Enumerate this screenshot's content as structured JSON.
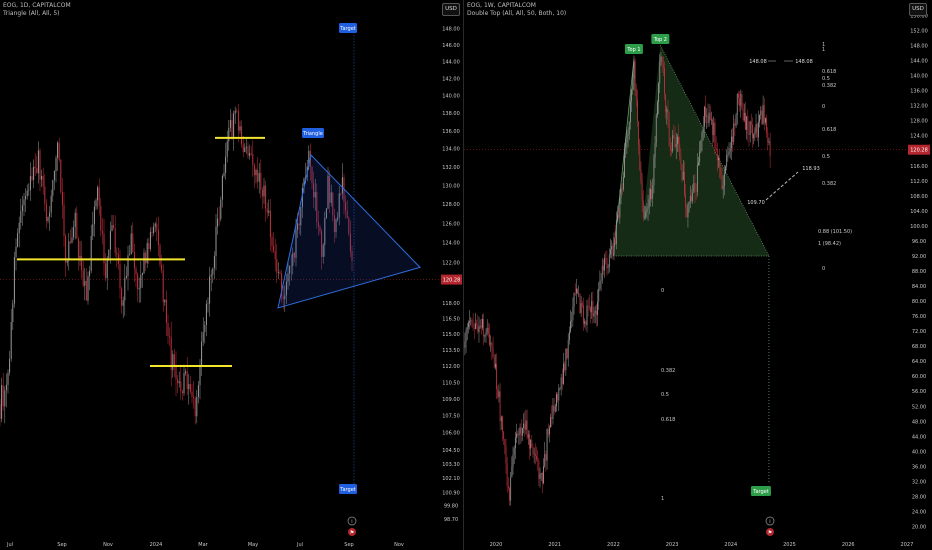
{
  "colors": {
    "up": "#9a9a9a",
    "down": "#c2323c",
    "price_line": "#b3262e",
    "price_badge": "#b3262e",
    "yellow": "#f3e42c",
    "triangle": "#2f6fe0",
    "target_badge": "#1f5fe0",
    "double_top_fill": "#1c3a1c",
    "peak_badge": "#2e9d4a",
    "fib_dash": "#8a8a8a"
  },
  "left_chart": {
    "header": {
      "line1": "EOG, 1D, CAPITALCOM",
      "line2": "Triangle (All, All, 5)"
    },
    "currency_button": "USD",
    "current_price_label": "120.28",
    "pattern_label": "Triangle",
    "target_labels": [
      "Target",
      "Target"
    ],
    "icon_names": [
      "info-circle-icon",
      "flag-icon"
    ]
  },
  "right_chart": {
    "header": {
      "line1": "EOG, 1W, CAPITALCOM",
      "line2": "Double Top (All, All, 50, Both, 10)"
    },
    "currency_button": "USD",
    "current_price_label": "120.28",
    "peak_labels": [
      "Top 1",
      "Top 2"
    ],
    "target_label": "Target",
    "price_annotations": [
      "148.08",
      "148.08",
      "118.93",
      "109.70"
    ],
    "fib_labels_upper": [
      "1",
      "1",
      "0.618",
      "0.5",
      "0.382",
      "0",
      "0.618",
      "0.5",
      "0.382",
      "0.88 (101.50)",
      "1 (98.42)",
      "0"
    ],
    "fib_labels_lower": [
      "0",
      "0.382",
      "0.5",
      "0.618",
      "1"
    ],
    "icon_names": [
      "info-circle-icon",
      "flag-icon"
    ]
  },
  "chart_data": [
    {
      "type": "candlestick",
      "title": "EOG, 1D, CAPITALCOM",
      "subtitle": "Triangle (All, All, 5)",
      "y_axis": {
        "ticks": [
          148.0,
          146.0,
          144.0,
          142.0,
          140.0,
          138.0,
          136.0,
          134.0,
          132.0,
          130.0,
          128.0,
          126.0,
          124.0,
          122.0,
          120.28,
          118.0,
          116.5,
          115.0,
          113.5,
          112.0,
          110.5,
          109.0,
          107.5,
          106.0,
          104.5,
          103.3,
          102.1,
          100.9,
          99.8,
          98.7
        ],
        "tick_labels": [
          "148.00",
          "146.00",
          "144.00",
          "142.00",
          "140.00",
          "138.00",
          "136.00",
          "134.00",
          "132.00",
          "130.00",
          "128.00",
          "126.00",
          "124.00",
          "122.00",
          "120.28",
          "118.00",
          "116.50",
          "115.00",
          "113.50",
          "112.00",
          "110.50",
          "109.00",
          "107.50",
          "106.00",
          "104.50",
          "103.30",
          "102.10",
          "100.90",
          "99.80",
          "98.70"
        ],
        "ylim": [
          97.5,
          150.5
        ],
        "scale": "log"
      },
      "x_axis": {
        "tick_labels": [
          "Jul",
          "Sep",
          "Nov",
          "2024",
          "Mar",
          "May",
          "Jul",
          "Sep",
          "Nov"
        ]
      },
      "last_price": 120.28,
      "approx_path": [
        {
          "t": 0,
          "price": 108.5
        },
        {
          "t": 8,
          "price": 111
        },
        {
          "t": 16,
          "price": 124
        },
        {
          "t": 26,
          "price": 129
        },
        {
          "t": 38,
          "price": 133
        },
        {
          "t": 48,
          "price": 126
        },
        {
          "t": 58,
          "price": 135
        },
        {
          "t": 66,
          "price": 122
        },
        {
          "t": 75,
          "price": 126
        },
        {
          "t": 86,
          "price": 118
        },
        {
          "t": 97,
          "price": 130
        },
        {
          "t": 105,
          "price": 121
        },
        {
          "t": 113,
          "price": 126
        },
        {
          "t": 122,
          "price": 118
        },
        {
          "t": 131,
          "price": 124
        },
        {
          "t": 139,
          "price": 119
        },
        {
          "t": 148,
          "price": 124
        },
        {
          "t": 157,
          "price": 126
        },
        {
          "t": 165,
          "price": 117
        },
        {
          "t": 172,
          "price": 112
        },
        {
          "t": 180,
          "price": 110
        },
        {
          "t": 188,
          "price": 111
        },
        {
          "t": 196,
          "price": 108.5
        },
        {
          "t": 204,
          "price": 116
        },
        {
          "t": 213,
          "price": 122
        },
        {
          "t": 222,
          "price": 130
        },
        {
          "t": 230,
          "price": 136
        },
        {
          "t": 236,
          "price": 137.5
        },
        {
          "t": 244,
          "price": 134
        },
        {
          "t": 252,
          "price": 132
        },
        {
          "t": 260,
          "price": 131
        },
        {
          "t": 268,
          "price": 127
        },
        {
          "t": 276,
          "price": 122
        },
        {
          "t": 284,
          "price": 118
        },
        {
          "t": 292,
          "price": 122
        },
        {
          "t": 300,
          "price": 127
        },
        {
          "t": 308,
          "price": 133
        },
        {
          "t": 316,
          "price": 128
        },
        {
          "t": 322,
          "price": 122
        },
        {
          "t": 328,
          "price": 130
        },
        {
          "t": 335,
          "price": 126
        },
        {
          "t": 342,
          "price": 131
        },
        {
          "t": 348,
          "price": 125
        },
        {
          "t": 353,
          "price": 120.28
        }
      ],
      "annotations": {
        "horizontal_levels": [
          {
            "price": 122.3,
            "from_t": 17,
            "to_t": 185
          },
          {
            "price": 112.0,
            "from_t": 150,
            "to_t": 232
          },
          {
            "price": 135.2,
            "from_t": 215,
            "to_t": 265
          }
        ],
        "triangle": {
          "apex_left": {
            "t": 278,
            "price": 117.5
          },
          "top": {
            "t": 311,
            "price": 133.3
          },
          "apex_right": {
            "t": 420,
            "price": 121.5
          }
        },
        "target_line_t": 354,
        "targets": [
          {
            "price": 148.6
          },
          {
            "price": 101.6
          }
        ]
      }
    },
    {
      "type": "candlestick",
      "title": "EOG, 1W, CAPITALCOM",
      "subtitle": "Double Top (All, All, 50, Both, 10)",
      "y_axis": {
        "ticks": [
          156,
          152,
          148,
          144,
          140,
          136,
          132,
          128,
          124,
          120.28,
          116,
          112,
          108,
          104,
          100,
          96,
          92,
          88,
          84,
          80,
          76,
          72,
          68,
          64,
          60,
          56,
          52,
          48,
          44,
          40,
          36,
          32,
          28,
          24,
          20
        ],
        "tick_labels": [
          "156.00",
          "152.00",
          "148.00",
          "144.00",
          "140.00",
          "136.00",
          "132.00",
          "128.00",
          "124.00",
          "120.28",
          "116.00",
          "112.00",
          "108.00",
          "104.00",
          "100.00",
          "96.00",
          "92.00",
          "88.00",
          "84.00",
          "80.00",
          "76.00",
          "72.00",
          "68.00",
          "64.00",
          "60.00",
          "56.00",
          "52.00",
          "48.00",
          "44.00",
          "40.00",
          "36.00",
          "32.00",
          "28.00",
          "24.00",
          "20.00"
        ],
        "ylim": [
          18,
          158
        ]
      },
      "x_axis": {
        "tick_labels": [
          "2020",
          "2021",
          "2022",
          "2023",
          "2024",
          "2025",
          "2026",
          "2027"
        ]
      },
      "last_price": 120.28,
      "approx_path": [
        {
          "t": 2019.05,
          "price": 86
        },
        {
          "t": 2019.25,
          "price": 78
        },
        {
          "t": 2019.45,
          "price": 70
        },
        {
          "t": 2019.65,
          "price": 74
        },
        {
          "t": 2019.85,
          "price": 72
        },
        {
          "t": 2020.0,
          "price": 60
        },
        {
          "t": 2020.15,
          "price": 40
        },
        {
          "t": 2020.22,
          "price": 28
        },
        {
          "t": 2020.35,
          "price": 44
        },
        {
          "t": 2020.5,
          "price": 48
        },
        {
          "t": 2020.65,
          "price": 38
        },
        {
          "t": 2020.8,
          "price": 32
        },
        {
          "t": 2020.9,
          "price": 48
        },
        {
          "t": 2021.05,
          "price": 54
        },
        {
          "t": 2021.2,
          "price": 66
        },
        {
          "t": 2021.35,
          "price": 82
        },
        {
          "t": 2021.5,
          "price": 76
        },
        {
          "t": 2021.7,
          "price": 78
        },
        {
          "t": 2021.85,
          "price": 90
        },
        {
          "t": 2022.0,
          "price": 94
        },
        {
          "t": 2022.15,
          "price": 112
        },
        {
          "t": 2022.35,
          "price": 142
        },
        {
          "t": 2022.5,
          "price": 104
        },
        {
          "t": 2022.65,
          "price": 108
        },
        {
          "t": 2022.8,
          "price": 148
        },
        {
          "t": 2022.95,
          "price": 122
        },
        {
          "t": 2023.1,
          "price": 124
        },
        {
          "t": 2023.25,
          "price": 104
        },
        {
          "t": 2023.4,
          "price": 110
        },
        {
          "t": 2023.55,
          "price": 132
        },
        {
          "t": 2023.7,
          "price": 126
        },
        {
          "t": 2023.85,
          "price": 112
        },
        {
          "t": 2024.0,
          "price": 120
        },
        {
          "t": 2024.12,
          "price": 136
        },
        {
          "t": 2024.25,
          "price": 128
        },
        {
          "t": 2024.4,
          "price": 124
        },
        {
          "t": 2024.55,
          "price": 130
        },
        {
          "t": 2024.67,
          "price": 120.28
        }
      ],
      "annotations": {
        "top1": {
          "t": 2022.35,
          "price": 144.5
        },
        "top2": {
          "t": 2022.8,
          "price": 148.08
        },
        "neckline_price": 92,
        "neckline_from_t": 2022.0,
        "neckline_to_t": 2024.65,
        "target_price": 31.5,
        "price_annotations": [
          148.08,
          118.93,
          109.7
        ]
      }
    }
  ]
}
